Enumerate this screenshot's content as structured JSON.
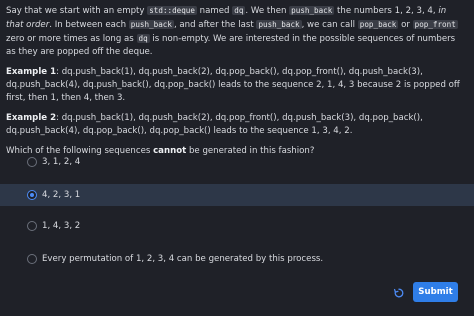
{
  "intro": {
    "t1": "Say that we start with an empty ",
    "c1": "std::deque",
    "t2": " named ",
    "c2": "dq",
    "t3": ". We then ",
    "c3": "push_back",
    "t4": " the numbers 1, 2, 3, 4, ",
    "em": "in that order",
    "t5": ". In between each ",
    "c4": "push_back",
    "t6": ", and after the last ",
    "c5": "push_back",
    "t7": ", we can call ",
    "c6": "pop_back",
    "t8": " or ",
    "c7": "pop_front",
    "t9": " zero or more times as long as ",
    "c8": "dq",
    "t10": " is non-empty. We are interested in the possible sequences of numbers as they are popped off the deque."
  },
  "example1": {
    "label": "Example 1",
    "text": ": dq.push_back(1), dq.push_back(2), dq.pop_back(), dq.pop_front(), dq.push_back(3), dq.push_back(4), dq.push_back(), dq.pop_back() leads to the sequence 2, 1, 4, 3 because 2 is popped off first, then 1, then 4, then 3."
  },
  "example2": {
    "label": "Example 2",
    "text": ": dq.push_back(1), dq.push_back(2), dq.pop_front(), dq.push_back(3), dq.pop_back(), dq.push_back(4), dq.pop_back(), dq.pop_back() leads to the sequence 1, 3, 4, 2."
  },
  "question": {
    "t1": "Which of the following sequences ",
    "strong": "cannot",
    "t2": " be generated in this fashion?"
  },
  "options": [
    {
      "label": "3, 1, 2, 4",
      "selected": false
    },
    {
      "label": "4, 2, 3, 1",
      "selected": true
    },
    {
      "label": "1, 4, 3, 2",
      "selected": false
    },
    {
      "label": "Every permutation of 1, 2, 3, 4 can be generated by this process.",
      "selected": false
    }
  ],
  "actions": {
    "submit_label": "Submit",
    "reset_icon": "reset-icon"
  },
  "colors": {
    "accent": "#2f7ee8",
    "background": "#1f2128",
    "selected_row": "#2d3748"
  }
}
